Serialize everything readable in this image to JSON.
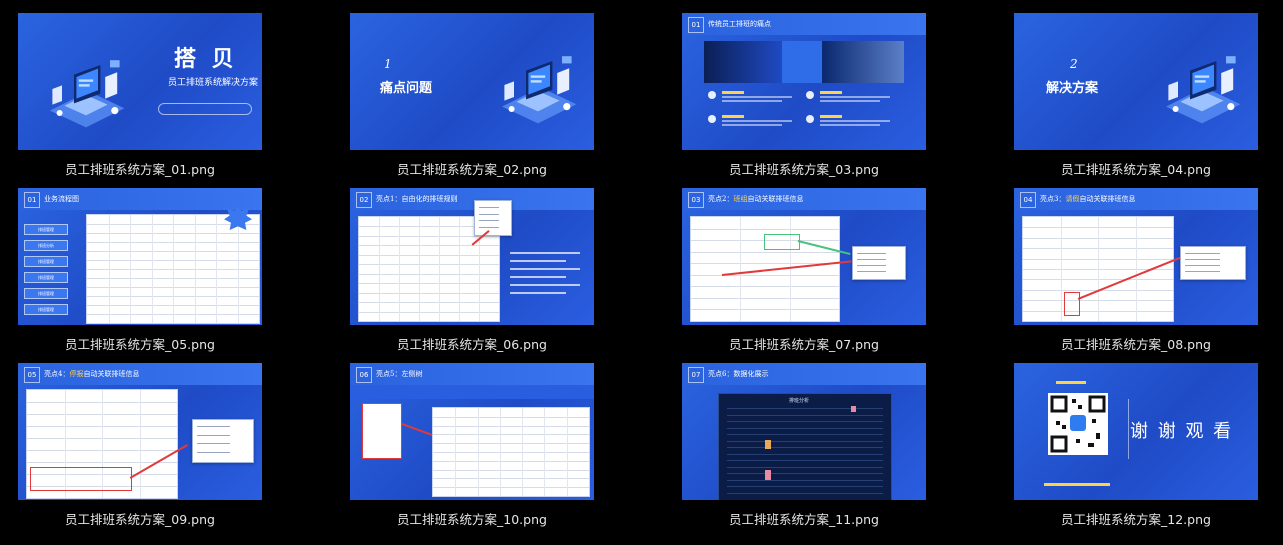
{
  "files": [
    {
      "name": "员工排班系统方案_01.png",
      "title": "搭 贝",
      "subtitle": "员工排班系统解决方案"
    },
    {
      "name": "员工排班系统方案_02.png",
      "number": "1",
      "title": "痛点问题"
    },
    {
      "name": "员工排班系统方案_03.png",
      "number": "01",
      "title": "传统员工排班的痛点"
    },
    {
      "name": "员工排班系统方案_04.png",
      "number": "2",
      "title": "解决方案"
    },
    {
      "name": "员工排班系统方案_05.png",
      "number": "01",
      "title": "业务流程图"
    },
    {
      "name": "员工排班系统方案_06.png",
      "number": "02",
      "title": "亮点1：自由化的排班规则"
    },
    {
      "name": "员工排班系统方案_07.png",
      "number": "03",
      "title": "亮点2：",
      "highlight": "班组",
      "title_suffix": "自动关联排班信息"
    },
    {
      "name": "员工排班系统方案_08.png",
      "number": "04",
      "title": "亮点3：",
      "highlight": "请假",
      "title_suffix": "自动关联排班信息"
    },
    {
      "name": "员工排班系统方案_09.png",
      "number": "05",
      "title": "亮点4：",
      "highlight": "停报",
      "title_suffix": "自动关联排班信息"
    },
    {
      "name": "员工排班系统方案_10.png",
      "number": "06",
      "title": "亮点5：左侧树"
    },
    {
      "name": "员工排班系统方案_11.png",
      "number": "07",
      "title": "亮点6：数据化展示",
      "dash_title": "排班分析"
    },
    {
      "name": "员工排班系统方案_12.png",
      "title": "谢 谢 观 看"
    }
  ],
  "slide05_menu": [
    "排班管理",
    "排班分析",
    "排班管理",
    "排班管理",
    "排班管理",
    "排班管理"
  ],
  "colors": {
    "background": "#000000",
    "slide_blue": "#2b64e0",
    "label": "#e6e6e6",
    "accent_red": "#e23a3a",
    "accent_yellow": "#ffd24a"
  }
}
